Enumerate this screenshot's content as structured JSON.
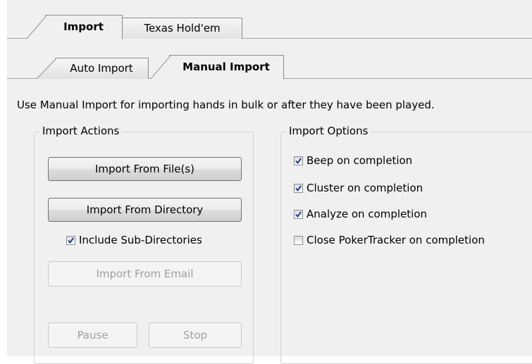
{
  "top_tabs": [
    {
      "label": "Import",
      "active": true
    },
    {
      "label": "Texas Hold'em",
      "active": false
    }
  ],
  "sub_tabs": [
    {
      "label": "Auto Import",
      "active": false
    },
    {
      "label": "Manual Import",
      "active": true
    }
  ],
  "description": "Use Manual Import for importing hands in bulk or after they have been played.",
  "import_actions": {
    "title": "Import Actions",
    "import_files_label": "Import From File(s)",
    "import_directory_label": "Import From Directory",
    "include_subdirs": {
      "label": "Include Sub-Directories",
      "checked": true
    },
    "import_email_label": "Import From Email",
    "pause_label": "Pause",
    "stop_label": "Stop"
  },
  "import_options": {
    "title": "Import Options",
    "items": [
      {
        "label": "Beep on completion",
        "checked": true
      },
      {
        "label": "Cluster on completion",
        "checked": true
      },
      {
        "label": "Analyze on completion",
        "checked": true
      },
      {
        "label": "Close PokerTracker on completion",
        "checked": false
      }
    ]
  },
  "colors": {
    "check_accent": "#1c3f8f",
    "disabled_text": "#a0a0a0"
  }
}
